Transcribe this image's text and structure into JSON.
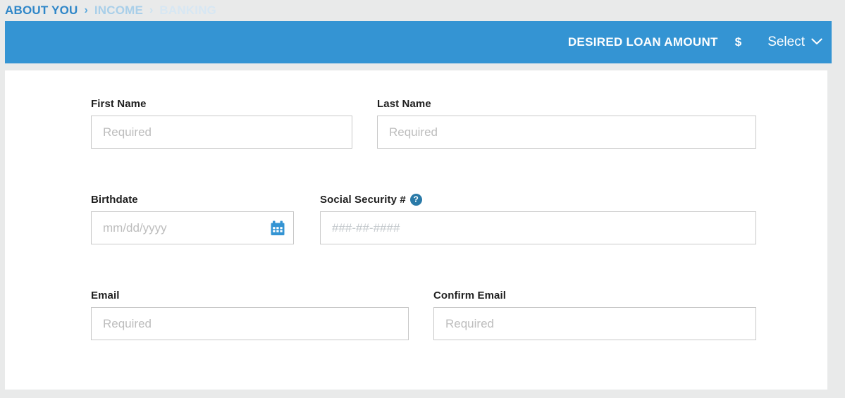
{
  "breadcrumb": {
    "steps": [
      {
        "label": "ABOUT YOU",
        "state": "active"
      },
      {
        "label": "INCOME",
        "state": "next"
      },
      {
        "label": "BANKING",
        "state": "future"
      }
    ],
    "separator": "›"
  },
  "header": {
    "loan_amount_label": "DESIRED LOAN AMOUNT",
    "currency_symbol": "$",
    "select_label": "Select",
    "chevron_icon": "chevron-down-icon",
    "bar_color": "#3494d3"
  },
  "form": {
    "first_name": {
      "label": "First Name",
      "value": "",
      "placeholder": "Required"
    },
    "last_name": {
      "label": "Last Name",
      "value": "",
      "placeholder": "Required"
    },
    "birthdate": {
      "label": "Birthdate",
      "value": "",
      "placeholder": "mm/dd/yyyy",
      "icon": "calendar-icon",
      "icon_color": "#3494d3"
    },
    "ssn": {
      "label": "Social Security #",
      "value": "",
      "placeholder": "###-##-####",
      "help_icon": "help-circle-icon",
      "help_icon_glyph": "?",
      "help_icon_color": "#2a7aa8"
    },
    "email": {
      "label": "Email",
      "value": "",
      "placeholder": "Required"
    },
    "confirm_email": {
      "label": "Confirm Email",
      "value": "",
      "placeholder": "Required"
    }
  }
}
